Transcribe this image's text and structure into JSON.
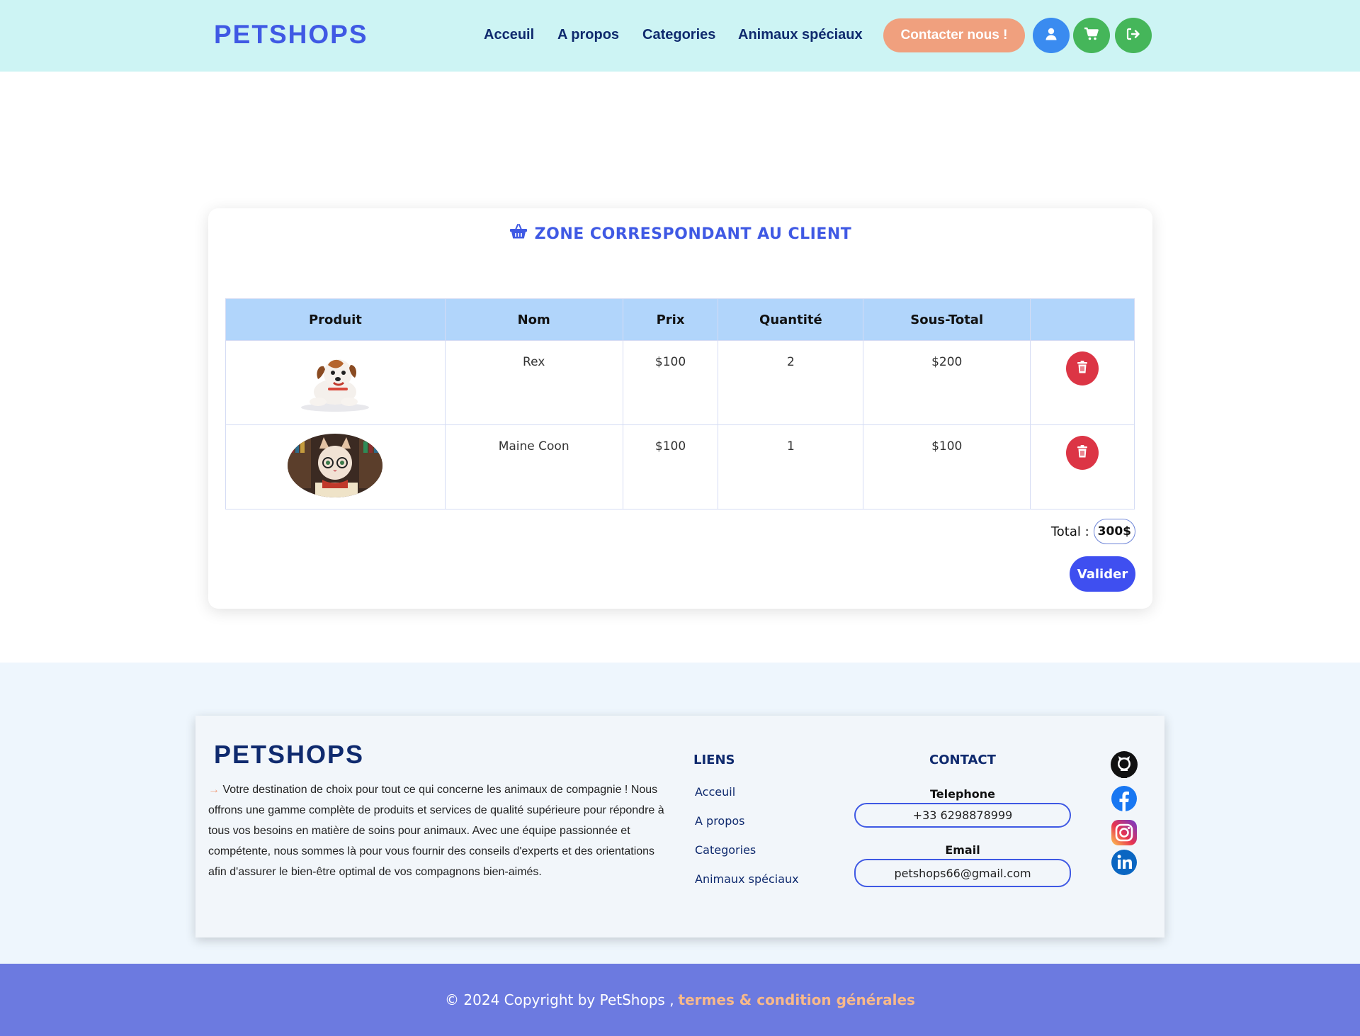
{
  "header": {
    "brand": "PETSHOPS",
    "nav": [
      "Acceuil",
      "A propos",
      "Categories",
      "Animaux spéciaux"
    ],
    "contact_button": "Contacter nous !",
    "icons": [
      "user-icon",
      "cart-icon",
      "logout-icon"
    ]
  },
  "cart": {
    "title": "ZONE CORRESPONDANT AU CLIENT",
    "title_icon": "basket-icon",
    "columns": [
      "Produit",
      "Nom",
      "Prix",
      "Quantité",
      "Sous-Total",
      ""
    ],
    "rows": [
      {
        "image": "dog-image",
        "name": "Rex",
        "price": "$100",
        "quantity": "2",
        "subtotal": "$200"
      },
      {
        "image": "cat-image",
        "name": "Maine Coon",
        "price": "$100",
        "quantity": "1",
        "subtotal": "$100"
      }
    ],
    "total_label": "Total :",
    "total_value": "300$",
    "validate_button": "Valider"
  },
  "footer": {
    "brand": "PETSHOPS",
    "description": "Votre destination de choix pour tout ce qui concerne les animaux de compagnie ! Nous offrons une gamme complète de produits et services de qualité supérieure pour répondre à tous vos besoins en matière de soins pour animaux. Avec une équipe passionnée et compétente, nous sommes là pour vous fournir des conseils d'experts et des orientations afin d'assurer le bien-être optimal de vos compagnons bien-aimés.",
    "links_heading": "LIENS",
    "links": [
      "Acceuil",
      "A propos",
      "Categories",
      "Animaux spéciaux"
    ],
    "contact_heading": "CONTACT",
    "phone_label": "Telephone",
    "phone": "+33 6298878999",
    "email_label": "Email",
    "email": "petshops66@gmail.com",
    "social": [
      "github-icon",
      "facebook-icon",
      "instagram-icon",
      "linkedin-icon"
    ]
  },
  "bottom": {
    "copyright": "© 2024 Copyright by PetShops ,",
    "terms": "termes & condition générales"
  },
  "colors": {
    "header_bg": "#cdf4f4",
    "brand": "#3f59e4",
    "accent": "#f0a07e",
    "delete": "#dc3545",
    "table_head": "#b1d5fb",
    "bottom_bar": "#6c7ae0"
  }
}
